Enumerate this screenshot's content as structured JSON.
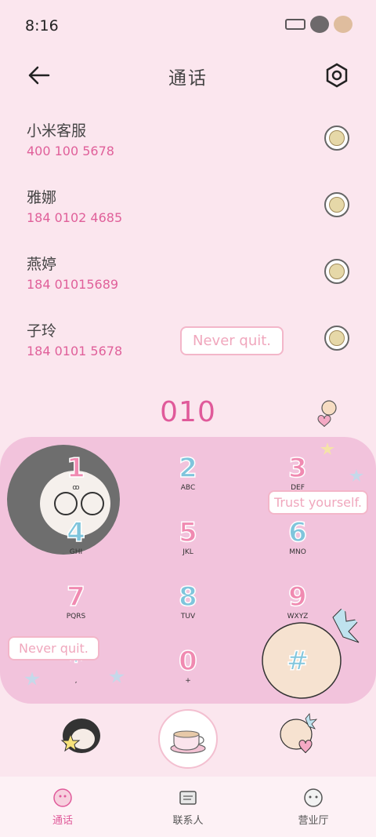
{
  "status_bar": {
    "time": "8:16"
  },
  "header": {
    "title": "通话"
  },
  "contacts": [
    {
      "name": "小米客服",
      "number": "400 100 5678"
    },
    {
      "name": "雅娜",
      "number": "184 0102 4685"
    },
    {
      "name": "燕婷",
      "number": "184 01015689"
    },
    {
      "name": "子玲",
      "number": "184 0101 5678"
    }
  ],
  "dialer": {
    "input_value": "010"
  },
  "bubbles": {
    "top": "Never quit.",
    "middle": "Trust yourself.",
    "bottom": "Never quit."
  },
  "keypad": {
    "k1": {
      "digit": "1",
      "letters": "ꝏ"
    },
    "k2": {
      "digit": "2",
      "letters": "ABC"
    },
    "k3": {
      "digit": "3",
      "letters": "DEF"
    },
    "k4": {
      "digit": "4",
      "letters": "GHI"
    },
    "k5": {
      "digit": "5",
      "letters": "JKL"
    },
    "k6": {
      "digit": "6",
      "letters": "MNO"
    },
    "k7": {
      "digit": "7",
      "letters": "PQRS"
    },
    "k8": {
      "digit": "8",
      "letters": "TUV"
    },
    "k9": {
      "digit": "9",
      "letters": "WXYZ"
    },
    "kstar": {
      "digit": "*",
      "letters": ","
    },
    "k0": {
      "digit": "0",
      "letters": "+"
    },
    "khash": {
      "digit": "#",
      "letters": ""
    }
  },
  "bottom_nav": [
    {
      "label": "通话",
      "icon": "phone-cartoon-icon",
      "active": true
    },
    {
      "label": "联系人",
      "icon": "contacts-cartoon-icon",
      "active": false
    },
    {
      "label": "营业厅",
      "icon": "store-cartoon-icon",
      "active": false
    }
  ],
  "colors": {
    "accent": "#e05a9a",
    "keypad_bg": "#f2c3dc",
    "bg": "#fbe6ee"
  }
}
